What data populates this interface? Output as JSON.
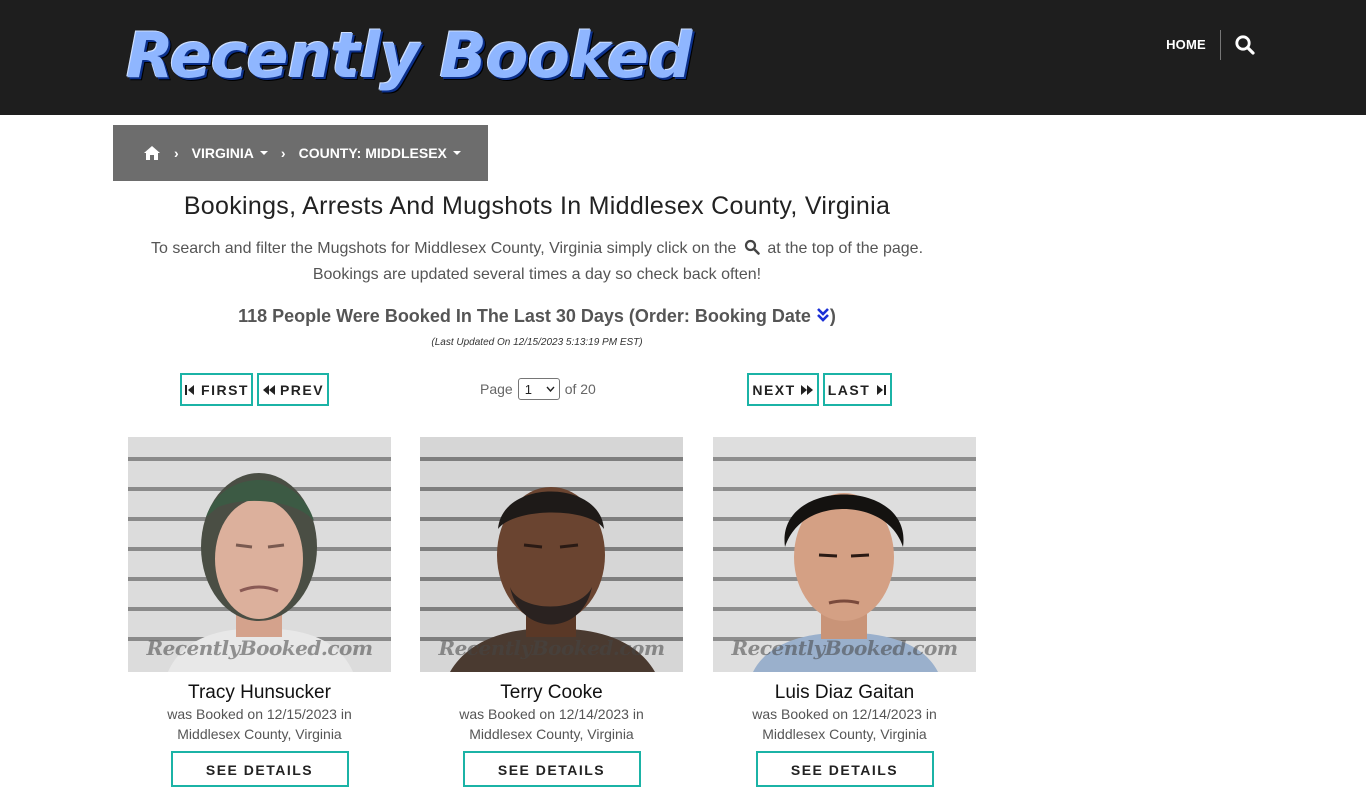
{
  "header": {
    "logo_text": "Recently Booked",
    "nav_home": "HOME",
    "search_icon": "search-icon"
  },
  "breadcrumb": {
    "home_icon": "home-icon",
    "state": "VIRGINIA",
    "county": "COUNTY: MIDDLESEX"
  },
  "page": {
    "title": "Bookings, Arrests And Mugshots In Middlesex County, Virginia",
    "intro_part1": "To search and filter the Mugshots for Middlesex County, Virginia simply click on the",
    "intro_part2": "at the top of the page.",
    "intro_line2": "Bookings are updated several times a day so check back often!",
    "count_text": "118 People Were Booked In The Last 30 Days (Order: Booking Date",
    "count_close": ")",
    "updated": "(Last Updated On 12/15/2023 5:13:19 PM EST)"
  },
  "pagination": {
    "first": "FIRST",
    "prev": "PREV",
    "page_label": "Page",
    "current_page": "1",
    "of_label": "of 20",
    "next": "NEXT",
    "last": "LAST"
  },
  "watermark": "RecentlyBooked.com",
  "cards": [
    {
      "name": "Tracy Hunsucker",
      "booked": "was Booked on 12/15/2023 in",
      "location": "Middlesex County, Virginia",
      "button": "SEE DETAILS"
    },
    {
      "name": "Terry Cooke",
      "booked": "was Booked on 12/14/2023 in",
      "location": "Middlesex County, Virginia",
      "button": "SEE DETAILS"
    },
    {
      "name": "Luis Diaz Gaitan",
      "booked": "was Booked on 12/14/2023 in",
      "location": "Middlesex County, Virginia",
      "button": "SEE DETAILS"
    }
  ],
  "colors": {
    "header_bg": "#1e1e1e",
    "breadcrumb_bg": "#6d6d6d",
    "accent_teal": "#1bb3a6",
    "order_icon": "#1a2fd6"
  }
}
